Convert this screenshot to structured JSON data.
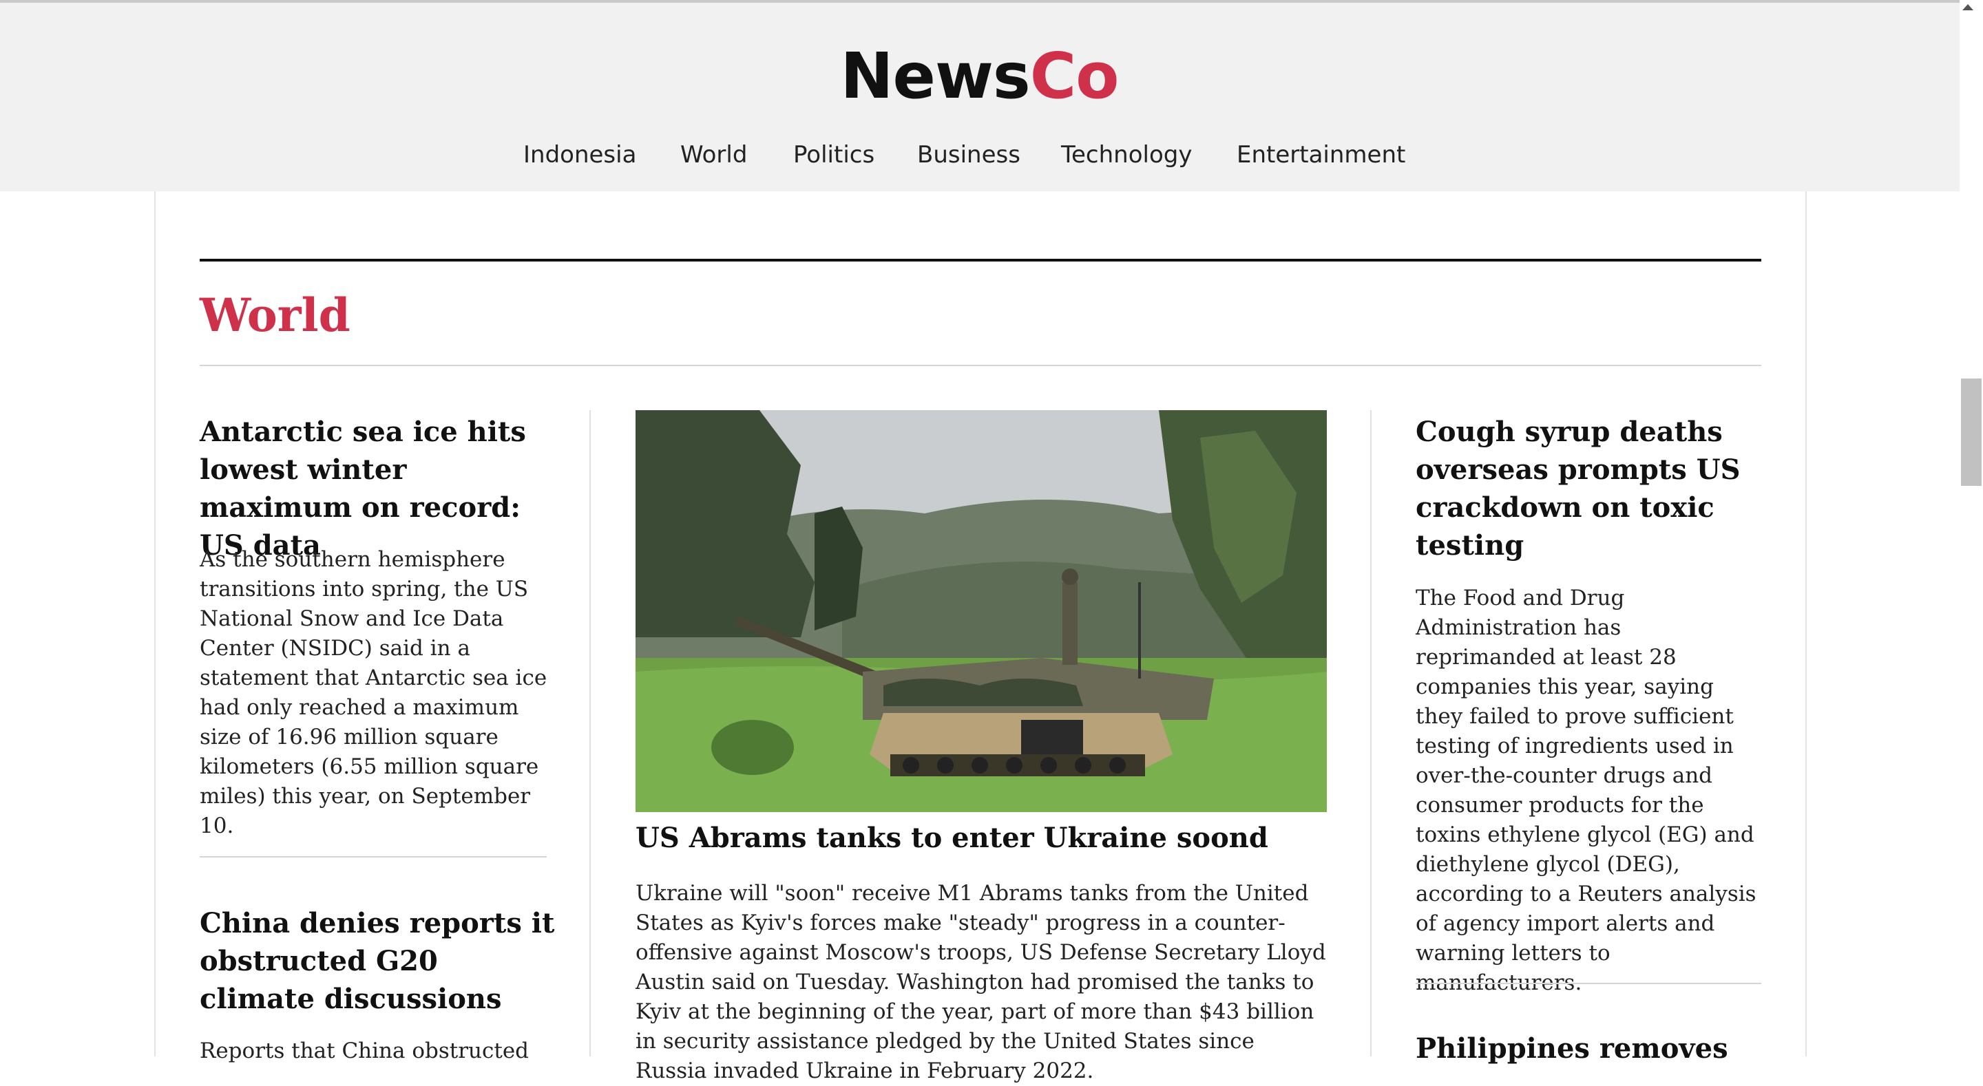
{
  "header": {
    "logo_main": "News",
    "logo_accent": "Co",
    "nav": [
      "Indonesia",
      "World",
      "Politics",
      "Business",
      "Technology",
      "Entertainment"
    ]
  },
  "section": {
    "title": "World"
  },
  "left_column": {
    "articles": [
      {
        "headline": "Antarctic sea ice hits lowest winter maximum on record: US data",
        "body": "As the southern hemisphere transitions into spring, the US National Snow and Ice Data Center (NSIDC) said in a statement that Antarctic sea ice had only reached a maximum size of 16.96 million square kilometers (6.55 million square miles) this year, on September 10."
      },
      {
        "headline": "China denies reports it obstructed G20 climate discussions",
        "body": "Reports that China obstructed"
      }
    ]
  },
  "center_column": {
    "headline": "US Abrams tanks to enter Ukraine soond",
    "body": "Ukraine will \"soon\" receive M1 Abrams tanks from the United States as Kyiv's forces make \"steady\" progress in a counter-offensive against Moscow's troops, US Defense Secretary Lloyd Austin said on Tuesday. Washington had promised the tanks to Kyiv at the beginning of the year, part of more than $43 billion in security assistance pledged by the United States since Russia invaded Ukraine in February 2022."
  },
  "right_column": {
    "articles": [
      {
        "headline": "Cough syrup deaths overseas prompts US crackdown on toxic testing",
        "body": "The Food and Drug Administration has reprimanded at least 28 companies this year, saying they failed to prove sufficient testing of ingredients used in over-the-counter drugs and consumer products for the toxins ethylene glycol (EG) and diethylene glycol (DEG), according to a Reuters analysis of agency import alerts and warning letters to manufacturers."
      },
      {
        "headline": "Philippines removes",
        "body": ""
      }
    ]
  },
  "colors": {
    "accent": "#d0314a",
    "header_bg": "#f1f1f1",
    "text": "#111111"
  },
  "icons": [
    "scroll-up-arrow-icon"
  ]
}
